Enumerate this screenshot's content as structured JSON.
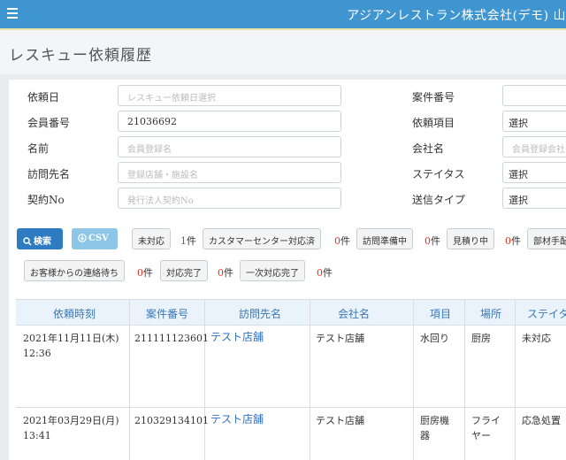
{
  "header": {
    "company": "アジアンレストラン株式会社(デモ) 山"
  },
  "page": {
    "title": "レスキュー依頼履歴"
  },
  "form": {
    "left": [
      {
        "label": "依頼日",
        "value": "",
        "placeholder": "レスキュー依頼日選択"
      },
      {
        "label": "会員番号",
        "value": "21036692",
        "placeholder": ""
      },
      {
        "label": "名前",
        "value": "",
        "placeholder": "会員登録名"
      },
      {
        "label": "訪問先名",
        "value": "",
        "placeholder": "登録店舗・施設名"
      },
      {
        "label": "契約No",
        "value": "",
        "placeholder": "発行法人契約No"
      }
    ],
    "right": [
      {
        "label": "案件番号",
        "value": "",
        "placeholder": ""
      },
      {
        "label": "依頼項目",
        "value": "選択",
        "placeholder": ""
      },
      {
        "label": "会社名",
        "value": "",
        "placeholder": "会員登録会社"
      },
      {
        "label": "ステイタス",
        "value": "選択",
        "placeholder": ""
      },
      {
        "label": "送信タイプ",
        "value": "選択",
        "placeholder": ""
      }
    ]
  },
  "actions": {
    "search": "検索",
    "csv": "CSV"
  },
  "filters_row1": [
    {
      "label": "未対応",
      "count": "1",
      "unit": "件",
      "color": "blue"
    },
    {
      "label": "カスタマーセンター対応済",
      "count": "0",
      "unit": "件",
      "color": "red"
    },
    {
      "label": "訪問準備中",
      "count": "0",
      "unit": "件",
      "color": "red"
    },
    {
      "label": "見積り中",
      "count": "0",
      "unit": "件",
      "color": "red"
    },
    {
      "label": "部材手配",
      "count": "",
      "unit": "",
      "color": "red"
    }
  ],
  "filters_row2": [
    {
      "label": "お客様からの連絡待ち",
      "count": "0",
      "unit": "件",
      "color": "red"
    },
    {
      "label": "対応完了",
      "count": "0",
      "unit": "件",
      "color": "red"
    },
    {
      "label": "一次対応完了",
      "count": "0",
      "unit": "件",
      "color": "red"
    }
  ],
  "table": {
    "headers": [
      "依頼時刻",
      "案件番号",
      "訪問先名",
      "会社名",
      "項目",
      "場所",
      "ステイタ"
    ],
    "rows": [
      {
        "time": [
          "2021年11月11日(木)",
          "12:36"
        ],
        "case": "211111123601",
        "visit": "テスト店舗",
        "company": "テスト店舗",
        "item": [
          "水回り"
        ],
        "place": [
          "厨房"
        ],
        "status": "未対応"
      },
      {
        "time": [
          "2021年03月29日(月)",
          "13:41"
        ],
        "case": "210329134101",
        "visit": "テスト店舗",
        "company": "テスト店舗",
        "item": [
          "厨房機",
          "器"
        ],
        "place": [
          "フライ",
          "ヤー"
        ],
        "status": "応急処置"
      }
    ]
  },
  "colors": {
    "topbar": "#3f95cf",
    "primary": "#2d7cc1",
    "csv": "#8ec6e8",
    "link": "#2d6fbf",
    "count_red": "#e0301e"
  }
}
